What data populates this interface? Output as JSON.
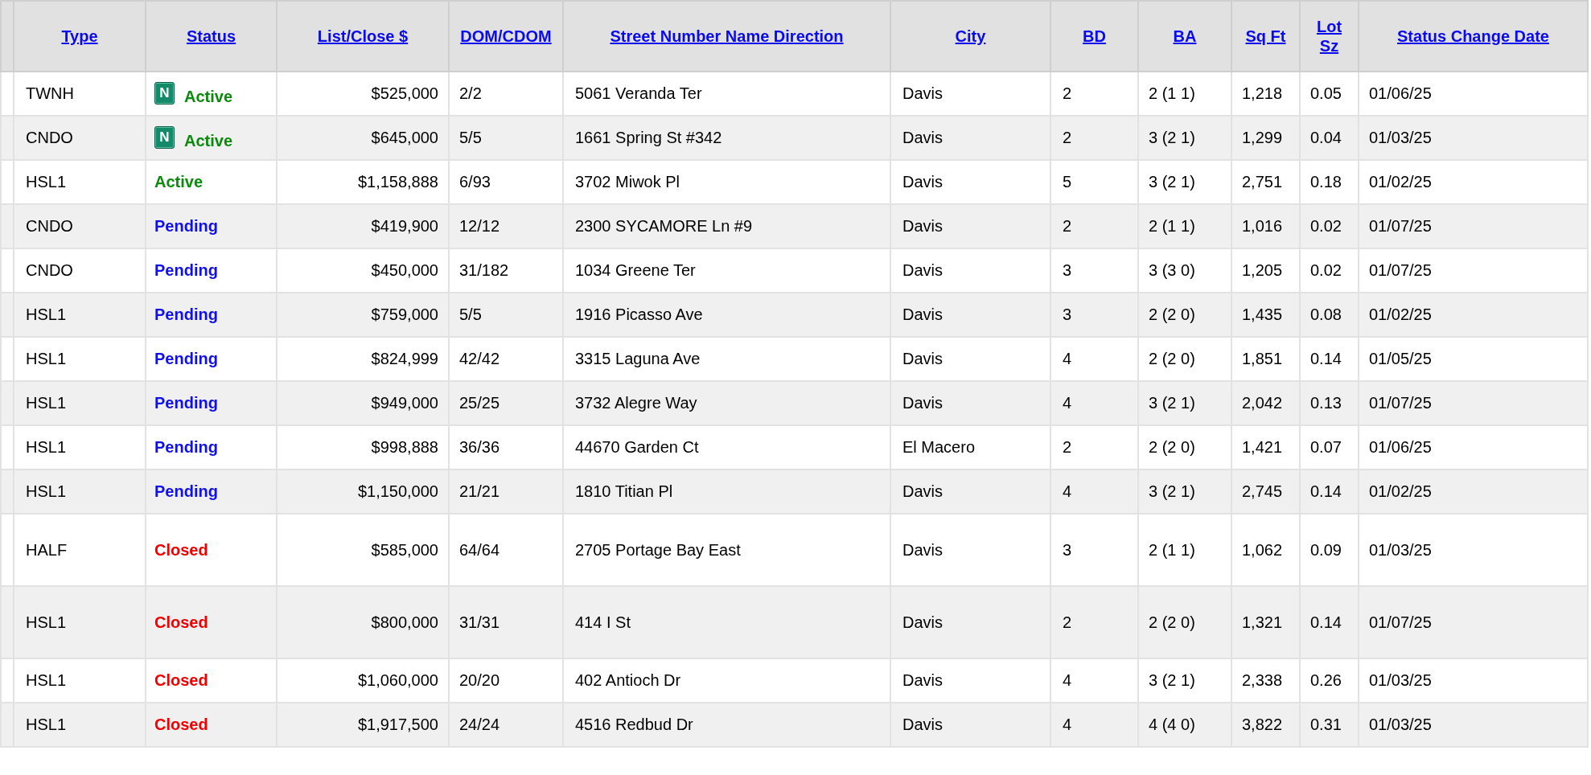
{
  "table": {
    "columns": [
      "Type",
      "Status",
      "List/Close $",
      "DOM/CDOM",
      "Street Number Name Direction",
      "City",
      "BD",
      "BA",
      "Sq Ft",
      "Lot Sz",
      "Status Change Date"
    ],
    "rows": [
      {
        "type": "TWNH",
        "status": "Active",
        "kind": "active",
        "badge": "N",
        "price": "$525,000",
        "dom": "2/2",
        "street": "5061 Veranda Ter",
        "city": "Davis",
        "bd": "2",
        "ba": "2 (1 1)",
        "sqft": "1,218",
        "lot": "0.05",
        "date": "01/06/25"
      },
      {
        "type": "CNDO",
        "status": "Active",
        "kind": "active",
        "badge": "N",
        "price": "$645,000",
        "dom": "5/5",
        "street": "1661 Spring St #342",
        "city": "Davis",
        "bd": "2",
        "ba": "3 (2 1)",
        "sqft": "1,299",
        "lot": "0.04",
        "date": "01/03/25"
      },
      {
        "type": "HSL1",
        "status": "Active",
        "kind": "active",
        "price": "$1,158,888",
        "dom": "6/93",
        "street": "3702 Miwok Pl",
        "city": "Davis",
        "bd": "5",
        "ba": "3 (2 1)",
        "sqft": "2,751",
        "lot": "0.18",
        "date": "01/02/25"
      },
      {
        "type": "CNDO",
        "status": "Pending",
        "kind": "pending",
        "price": "$419,900",
        "dom": "12/12",
        "street": "2300 SYCAMORE Ln #9",
        "city": "Davis",
        "bd": "2",
        "ba": "2 (1 1)",
        "sqft": "1,016",
        "lot": "0.02",
        "date": "01/07/25"
      },
      {
        "type": "CNDO",
        "status": "Pending",
        "kind": "pending",
        "price": "$450,000",
        "dom": "31/182",
        "street": "1034 Greene Ter",
        "city": "Davis",
        "bd": "3",
        "ba": "3 (3 0)",
        "sqft": "1,205",
        "lot": "0.02",
        "date": "01/07/25"
      },
      {
        "type": "HSL1",
        "status": "Pending",
        "kind": "pending",
        "price": "$759,000",
        "dom": "5/5",
        "street": "1916 Picasso Ave",
        "city": "Davis",
        "bd": "3",
        "ba": "2 (2 0)",
        "sqft": "1,435",
        "lot": "0.08",
        "date": "01/02/25"
      },
      {
        "type": "HSL1",
        "status": "Pending",
        "kind": "pending",
        "price": "$824,999",
        "dom": "42/42",
        "street": "3315 Laguna Ave",
        "city": "Davis",
        "bd": "4",
        "ba": "2 (2 0)",
        "sqft": "1,851",
        "lot": "0.14",
        "date": "01/05/25"
      },
      {
        "type": "HSL1",
        "status": "Pending",
        "kind": "pending",
        "price": "$949,000",
        "dom": "25/25",
        "street": "3732 Alegre Way",
        "city": "Davis",
        "bd": "4",
        "ba": "3 (2 1)",
        "sqft": "2,042",
        "lot": "0.13",
        "date": "01/07/25"
      },
      {
        "type": "HSL1",
        "status": "Pending",
        "kind": "pending",
        "price": "$998,888",
        "dom": "36/36",
        "street": "44670 Garden Ct",
        "city": "El Macero",
        "bd": "2",
        "ba": "2 (2 0)",
        "sqft": "1,421",
        "lot": "0.07",
        "date": "01/06/25"
      },
      {
        "type": "HSL1",
        "status": "Pending",
        "kind": "pending",
        "price": "$1,150,000",
        "dom": "21/21",
        "street": "1810 Titian Pl",
        "city": "Davis",
        "bd": "4",
        "ba": "3 (2 1)",
        "sqft": "2,745",
        "lot": "0.14",
        "date": "01/02/25"
      },
      {
        "type": "HALF",
        "status": "Closed",
        "kind": "closed",
        "price": "$585,000",
        "dom": "64/64",
        "street": "2705 Portage Bay East",
        "city": "Davis",
        "bd": "3",
        "ba": "2 (1 1)",
        "sqft": "1,062",
        "lot": "0.09",
        "date": "01/03/25"
      },
      {
        "type": "HSL1",
        "status": "Closed",
        "kind": "closed",
        "price": "$800,000",
        "dom": "31/31",
        "street": "414 I St",
        "city": "Davis",
        "bd": "2",
        "ba": "2 (2 0)",
        "sqft": "1,321",
        "lot": "0.14",
        "date": "01/07/25"
      },
      {
        "type": "HSL1",
        "status": "Closed",
        "kind": "closed",
        "price": "$1,060,000",
        "dom": "20/20",
        "street": "402 Antioch Dr",
        "city": "Davis",
        "bd": "4",
        "ba": "3 (2 1)",
        "sqft": "2,338",
        "lot": "0.26",
        "date": "01/03/25"
      },
      {
        "type": "HSL1",
        "status": "Closed",
        "kind": "closed",
        "price": "$1,917,500",
        "dom": "24/24",
        "street": "4516 Redbud Dr",
        "city": "Davis",
        "bd": "4",
        "ba": "4 (4 0)",
        "sqft": "3,822",
        "lot": "0.31",
        "date": "01/03/25"
      }
    ]
  }
}
